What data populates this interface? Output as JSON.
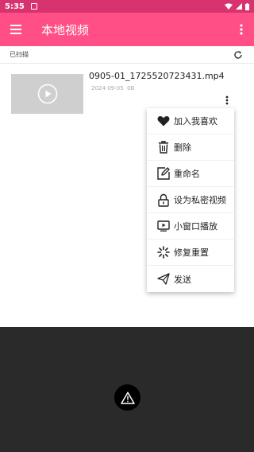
{
  "status": {
    "time": "5:35"
  },
  "appbar": {
    "title": "本地视频"
  },
  "scan": {
    "label": "已扫描"
  },
  "video": {
    "filename": "0905-01_1725520723431.mp4",
    "date": "2024-09-05",
    "size": "0B"
  },
  "menu": [
    {
      "label": "加入我喜欢",
      "icon": "heart-icon"
    },
    {
      "label": "删除",
      "icon": "trash-icon"
    },
    {
      "label": "重命名",
      "icon": "rename-icon"
    },
    {
      "label": "设为私密视频",
      "icon": "lock-icon"
    },
    {
      "label": "小窗口播放",
      "icon": "mini-window-icon"
    },
    {
      "label": "修复重置",
      "icon": "repair-icon"
    },
    {
      "label": "发送",
      "icon": "send-icon"
    }
  ],
  "colors": {
    "accent": "#ff4f86",
    "statusbar": "#d9336f",
    "player_bg": "#2a2a2a",
    "thumb": "#cfcfcf"
  }
}
